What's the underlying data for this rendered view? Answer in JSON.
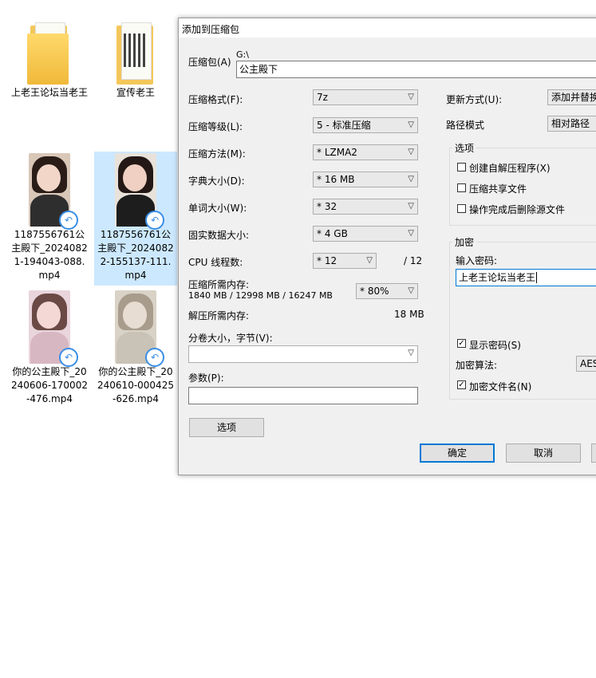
{
  "desktop": {
    "items": [
      {
        "label": "上老王论坛当老王"
      },
      {
        "label": "宣传老王"
      },
      {
        "label": "1187556761公主殿下_20240821-194043-088.mp4"
      },
      {
        "label": "1187556761公主殿下_20240822-155137-111.mp4"
      },
      {
        "label": "你的公主殿下_20240606-170002-476.mp4"
      },
      {
        "label": "你的公主殿下_20240610-000425-626.mp4"
      }
    ]
  },
  "dialog": {
    "title": "添加到压缩包",
    "archive_label": "压缩包(A)",
    "archive_path": "G:\\",
    "archive_name": "公主殿下",
    "format_label": "压缩格式(F):",
    "format_value": "7z",
    "level_label": "压缩等级(L):",
    "level_value": "5 - 标准压缩",
    "method_label": "压缩方法(M):",
    "method_value": "* LZMA2",
    "dict_label": "字典大小(D):",
    "dict_value": "* 16 MB",
    "word_label": "单词大小(W):",
    "word_value": "* 32",
    "solid_label": "固实数据大小:",
    "solid_value": "* 4 GB",
    "threads_label": "CPU 线程数:",
    "threads_value": "* 12",
    "threads_max": "/ 12",
    "mem_label": "压缩所需内存:",
    "mem_detail": "1840 MB / 12998 MB / 16247 MB",
    "mem_value": "* 80%",
    "decomp_label": "解压所需内存:",
    "decomp_value": "18 MB",
    "split_label": "分卷大小，字节(V):",
    "split_value": "",
    "params_label": "参数(P):",
    "params_value": "",
    "options_button": "选项",
    "update_label": "更新方式(U):",
    "update_value": "添加并替换",
    "path_label": "路径模式",
    "path_value": "相对路径",
    "options_group": "选项",
    "opt_sfx": "创建自解压程序(X)",
    "opt_shared": "压缩共享文件",
    "opt_delete": "操作完成后删除源文件",
    "enc_group": "加密",
    "password_label": "输入密码:",
    "password_value": "上老王论坛当老王",
    "show_password": "显示密码(S)",
    "enc_method_label": "加密算法:",
    "enc_method_value": "AES",
    "enc_names": "加密文件名(N)",
    "ok_button": "确定",
    "cancel_button": "取消"
  }
}
